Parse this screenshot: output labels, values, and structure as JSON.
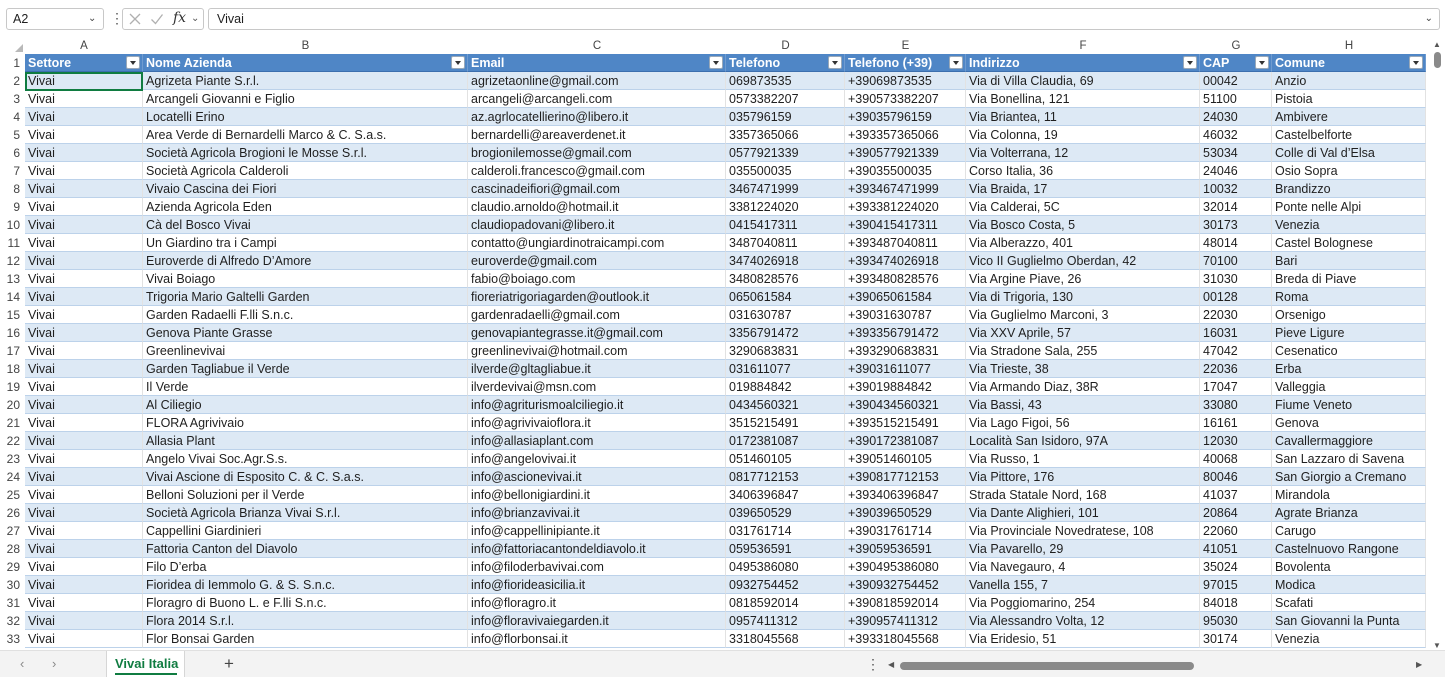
{
  "formula_bar": {
    "name_box": "A2",
    "fx_label": "fx",
    "formula_value": "Vivai"
  },
  "column_letters": [
    "A",
    "B",
    "C",
    "D",
    "E",
    "F",
    "G",
    "H"
  ],
  "header_row_number": "1",
  "headers": [
    "Settore",
    "Nome Azienda",
    "Email",
    "Telefono",
    "Telefono (+39)",
    "Indirizzo",
    "CAP",
    "Comune"
  ],
  "rows": [
    {
      "n": "2",
      "cells": [
        "Vivai",
        "Agrizeta Piante S.r.l.",
        "agrizetaonline@gmail.com",
        "069873535",
        "+39069873535",
        "Via di Villa Claudia, 69",
        "00042",
        "Anzio"
      ]
    },
    {
      "n": "3",
      "cells": [
        "Vivai",
        "Arcangeli Giovanni e Figlio",
        "arcangeli@arcangeli.com",
        "0573382207",
        "+390573382207",
        "Via Bonellina, 121",
        "51100",
        "Pistoia"
      ]
    },
    {
      "n": "4",
      "cells": [
        "Vivai",
        "Locatelli Erino",
        "az.agrlocatellierino@libero.it",
        "035796159",
        "+39035796159",
        "Via Briantea, 11",
        "24030",
        "Ambivere"
      ]
    },
    {
      "n": "5",
      "cells": [
        "Vivai",
        "Area Verde di Bernardelli Marco & C. S.a.s.",
        "bernardelli@areaverdenet.it",
        "3357365066",
        "+393357365066",
        "Via Colonna, 19",
        "46032",
        "Castelbelforte"
      ]
    },
    {
      "n": "6",
      "cells": [
        "Vivai",
        "Società Agricola Brogioni le Mosse S.r.l.",
        "brogionilemosse@gmail.com",
        "0577921339",
        "+390577921339",
        "Via Volterrana, 12",
        "53034",
        "Colle di Val d’Elsa"
      ]
    },
    {
      "n": "7",
      "cells": [
        "Vivai",
        "Società Agricola Calderoli",
        "calderoli.francesco@gmail.com",
        "035500035",
        "+39035500035",
        "Corso Italia, 36",
        "24046",
        "Osio Sopra"
      ]
    },
    {
      "n": "8",
      "cells": [
        "Vivai",
        "Vivaio Cascina dei Fiori",
        "cascinadeifiori@gmail.com",
        "3467471999",
        "+393467471999",
        "Via Braida, 17",
        "10032",
        "Brandizzo"
      ]
    },
    {
      "n": "9",
      "cells": [
        "Vivai",
        "Azienda Agricola Eden",
        "claudio.arnoldo@hotmail.it",
        "3381224020",
        "+393381224020",
        "Via Calderai, 5C",
        "32014",
        "Ponte nelle Alpi"
      ]
    },
    {
      "n": "10",
      "cells": [
        "Vivai",
        "Cà del Bosco Vivai",
        "claudiopadovani@libero.it",
        "0415417311",
        "+390415417311",
        "Via Bosco Costa, 5",
        "30173",
        "Venezia"
      ]
    },
    {
      "n": "11",
      "cells": [
        "Vivai",
        "Un Giardino tra i Campi",
        "contatto@ungiardinotraicampi.com",
        "3487040811",
        "+393487040811",
        "Via Alberazzo, 401",
        "48014",
        "Castel Bolognese"
      ]
    },
    {
      "n": "12",
      "cells": [
        "Vivai",
        "Euroverde di Alfredo D’Amore",
        "euroverde@gmail.com",
        "3474026918",
        "+393474026918",
        "Vico II Guglielmo Oberdan, 42",
        "70100",
        "Bari"
      ]
    },
    {
      "n": "13",
      "cells": [
        "Vivai",
        "Vivai Boiago",
        "fabio@boiago.com",
        "3480828576",
        "+393480828576",
        "Via Argine Piave, 26",
        "31030",
        "Breda di Piave"
      ]
    },
    {
      "n": "14",
      "cells": [
        "Vivai",
        "Trigoria Mario Galtelli Garden",
        "fioreriatrigoriagarden@outlook.it",
        "065061584",
        "+39065061584",
        "Via di Trigoria, 130",
        "00128",
        "Roma"
      ]
    },
    {
      "n": "15",
      "cells": [
        "Vivai",
        "Garden Radaelli F.lli S.n.c.",
        "gardenradaelli@gmail.com",
        "031630787",
        "+39031630787",
        "Via Guglielmo Marconi, 3",
        "22030",
        "Orsenigo"
      ]
    },
    {
      "n": "16",
      "cells": [
        "Vivai",
        "Genova Piante Grasse",
        "genovapiantegrasse.it@gmail.com",
        "3356791472",
        "+393356791472",
        "Via XXV Aprile, 57",
        "16031",
        "Pieve Ligure"
      ]
    },
    {
      "n": "17",
      "cells": [
        "Vivai",
        "Greenlinevivai",
        "greenlinevivai@hotmail.com",
        "3290683831",
        "+393290683831",
        "Via Stradone Sala, 255",
        "47042",
        "Cesenatico"
      ]
    },
    {
      "n": "18",
      "cells": [
        "Vivai",
        "Garden Tagliabue il Verde",
        "ilverde@gltagliabue.it",
        "031611077",
        "+39031611077",
        "Via Trieste, 38",
        "22036",
        "Erba"
      ]
    },
    {
      "n": "19",
      "cells": [
        "Vivai",
        "Il Verde",
        "ilverdevivai@msn.com",
        "019884842",
        "+39019884842",
        "Via Armando Diaz, 38R",
        "17047",
        "Valleggia"
      ]
    },
    {
      "n": "20",
      "cells": [
        "Vivai",
        "Al Ciliegio",
        "info@agriturismoalciliegio.it",
        "0434560321",
        "+390434560321",
        "Via Bassi, 43",
        "33080",
        "Fiume Veneto"
      ]
    },
    {
      "n": "21",
      "cells": [
        "Vivai",
        "FLORA Agrivivaio",
        "info@agrivivaioflora.it",
        "3515215491",
        "+393515215491",
        "Via Lago Figoi, 56",
        "16161",
        "Genova"
      ]
    },
    {
      "n": "22",
      "cells": [
        "Vivai",
        "Allasia Plant",
        "info@allasiaplant.com",
        "0172381087",
        "+390172381087",
        "Località San Isidoro, 97A",
        "12030",
        "Cavallermaggiore"
      ]
    },
    {
      "n": "23",
      "cells": [
        "Vivai",
        "Angelo Vivai Soc.Agr.S.s.",
        "info@angelovivai.it",
        "051460105",
        "+39051460105",
        "Via Russo, 1",
        "40068",
        "San Lazzaro di Savena"
      ]
    },
    {
      "n": "24",
      "cells": [
        "Vivai",
        "Vivai Ascione di Esposito C. & C. S.a.s.",
        "info@ascionevivai.it",
        "0817712153",
        "+390817712153",
        "Via Pittore, 176",
        "80046",
        "San Giorgio a Cremano"
      ]
    },
    {
      "n": "25",
      "cells": [
        "Vivai",
        "Belloni Soluzioni per il Verde",
        "info@bellonigiardini.it",
        "3406396847",
        "+393406396847",
        "Strada Statale Nord, 168",
        "41037",
        "Mirandola"
      ]
    },
    {
      "n": "26",
      "cells": [
        "Vivai",
        "Società Agricola Brianza Vivai S.r.l.",
        "info@brianzavivai.it",
        "039650529",
        "+39039650529",
        "Via Dante Alighieri, 101",
        "20864",
        "Agrate Brianza"
      ]
    },
    {
      "n": "27",
      "cells": [
        "Vivai",
        "Cappellini Giardinieri",
        "info@cappellinipiante.it",
        "031761714",
        "+39031761714",
        "Via Provinciale Novedratese, 108",
        "22060",
        "Carugo"
      ]
    },
    {
      "n": "28",
      "cells": [
        "Vivai",
        "Fattoria Canton del Diavolo",
        "info@fattoriacantondeldiavolo.it",
        "059536591",
        "+39059536591",
        "Via Pavarello, 29",
        "41051",
        "Castelnuovo Rangone"
      ]
    },
    {
      "n": "29",
      "cells": [
        "Vivai",
        "Filo D’erba",
        "info@filoderbavivai.com",
        "0495386080",
        "+390495386080",
        "Via Navegauro, 4",
        "35024",
        "Bovolenta"
      ]
    },
    {
      "n": "30",
      "cells": [
        "Vivai",
        "Fioridea di Iemmolo G. & S. S.n.c.",
        "info@fiorideasicilia.it",
        "0932754452",
        "+390932754452",
        "Vanella 155, 7",
        "97015",
        "Modica"
      ]
    },
    {
      "n": "31",
      "cells": [
        "Vivai",
        "Floragro di Buono L. e F.lli S.n.c.",
        "info@floragro.it",
        "0818592014",
        "+390818592014",
        "Via Poggiomarino, 254",
        "84018",
        "Scafati"
      ]
    },
    {
      "n": "32",
      "cells": [
        "Vivai",
        "Flora 2014 S.r.l.",
        "info@floravivaiegarden.it",
        "0957411312",
        "+390957411312",
        "Via Alessandro Volta, 12",
        "95030",
        "San Giovanni la Punta"
      ]
    },
    {
      "n": "33",
      "cells": [
        "Vivai",
        "Flor Bonsai Garden",
        "info@florbonsai.it",
        "3318045568",
        "+393318045568",
        "Via Eridesio, 51",
        "30174",
        "Venezia"
      ]
    }
  ],
  "sheet_tabs": [
    "Vivai Italia"
  ],
  "add_sheet_label": "+",
  "colors": {
    "header_fill": "#4f86c6",
    "band_fill": "#dde9f5",
    "accent_green": "#107c41"
  }
}
